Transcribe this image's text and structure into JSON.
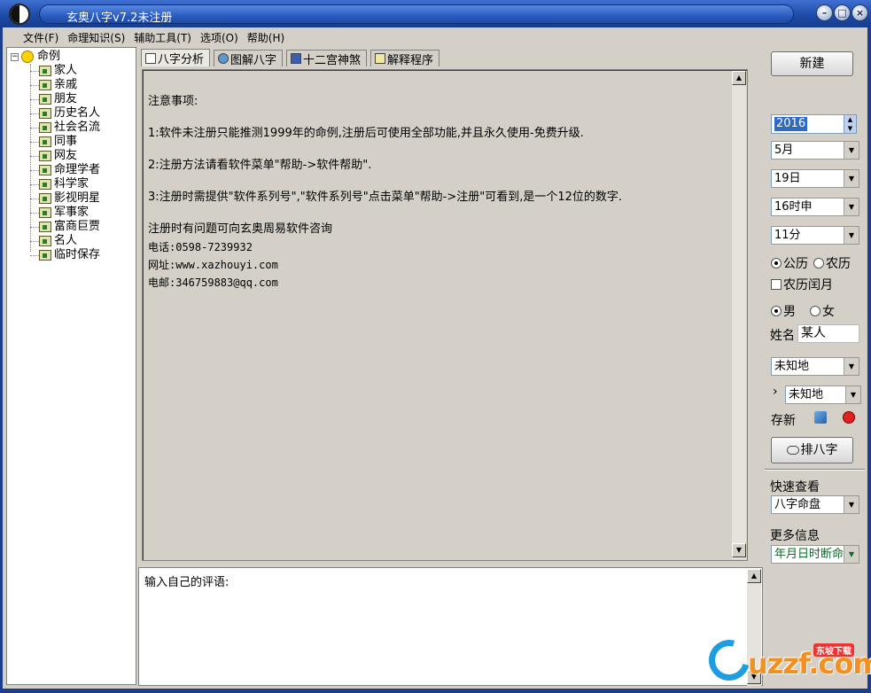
{
  "window": {
    "title": "玄奥八字v7.2未注册"
  },
  "menu": [
    "文件(F)",
    "命理知识(S)",
    "辅助工具(T)",
    "选项(O)",
    "帮助(H)"
  ],
  "tree": {
    "root": "命例",
    "children": [
      "家人",
      "亲戚",
      "朋友",
      "历史名人",
      "社会名流",
      "同事",
      "网友",
      "命理学者",
      "科学家",
      "影视明星",
      "军事家",
      "富商巨贾",
      "名人",
      "临时保存"
    ]
  },
  "tabs": [
    "八字分析",
    "图解八字",
    "十二宫神煞",
    "解释程序"
  ],
  "notice": {
    "heading": "注意事项:",
    "item1": "1:软件未注册只能推测1999年的命例,注册后可使用全部功能,并且永久使用-免费升级.",
    "item2": "2:注册方法请看软件菜单\"帮助->软件帮助\".",
    "item3": "3:注册时需提供\"软件系列号\",\"软件系列号\"点击菜单\"帮助->注册\"可看到,是一个12位的数字.",
    "contact_intro": "注册时有问题可向玄奥周易软件咨询",
    "phone": "电话:0598-7239932",
    "website": "网址:www.xazhouyi.com",
    "email": "电邮:346759883@qq.com"
  },
  "comment": {
    "label": "输入自己的评语:"
  },
  "panel": {
    "new_button": "新建",
    "year": "2016",
    "month": "5月",
    "day": "19日",
    "hour": "16时申",
    "minute": "11分",
    "calendar_solar": "公历",
    "calendar_lunar": "农历",
    "leap_month": "农历闰月",
    "male": "男",
    "female": "女",
    "name_label": "姓名",
    "name_value": "某人",
    "place1": "未知地",
    "place2": "未知地",
    "place_arrow": "›",
    "save_new": "存新",
    "paibazi_button": "排八字",
    "quick_view_label": "快速查看",
    "quick_view_value": "八字命盘",
    "more_info_label": "更多信息",
    "more_info_value": "年月日时断命"
  },
  "watermark": {
    "text": "uzzf.com",
    "badge": "东坡下载"
  },
  "colors": {
    "titlebar": "#1d4ba8",
    "face": "#d4d0c8",
    "selection": "#316ac5",
    "more_info_text": "#0a6a2a",
    "watermark_orange": "#f3901f",
    "watermark_blue": "#1e9de0"
  }
}
